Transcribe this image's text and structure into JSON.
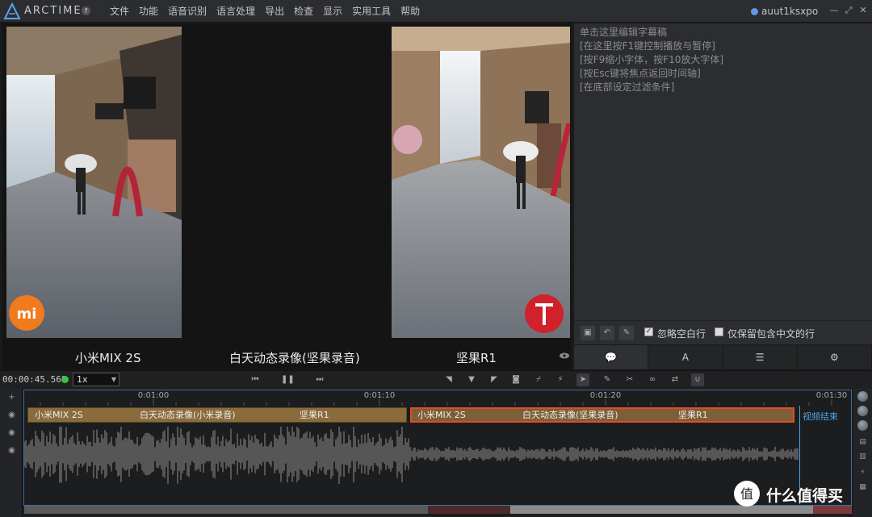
{
  "app": {
    "brand": "ARCTIME",
    "badge": "f",
    "menu": [
      "文件",
      "功能",
      "语音识别",
      "语言处理",
      "导出",
      "检查",
      "显示",
      "实用工具",
      "帮助"
    ],
    "user": "auut1ksxpo"
  },
  "video": {
    "captions": {
      "left": "小米MIX 2S",
      "center": "白天动态录像(坚果录音)",
      "right": "坚果R1"
    }
  },
  "subtitle_panel": {
    "lines": [
      "单击这里编辑字幕稿",
      "[在这里按F1键控制播放与暂停]",
      "[按F9缩小字体，按F10放大字体]",
      "[按Esc键将焦点返回时间轴]",
      "[在底部设定过滤条件]"
    ],
    "ignore_blank_label": "忽略空白行",
    "ignore_blank_checked": true,
    "keep_chinese_label": "仅保留包含中文的行",
    "keep_chinese_checked": false,
    "tabs": [
      "comment-icon",
      "font-icon",
      "list-icon",
      "settings-icon"
    ]
  },
  "transport": {
    "timecode": "00:00:45.568",
    "speed": "1x"
  },
  "timeline": {
    "ticks": [
      "0:01:00",
      "0:01:10",
      "0:01:20",
      "0:01:30"
    ],
    "segments": [
      {
        "parts": [
          "小米MIX 2S",
          "白天动态录像(小米录音)",
          "坚果R1"
        ]
      },
      {
        "parts": [
          "小米MIX 2S",
          "白天动态录像(坚果录音)",
          "坚果R1"
        ]
      }
    ],
    "end_label": "视频结束"
  },
  "watermark": {
    "text": "什么值得买",
    "logo_char": "值"
  },
  "colors": {
    "accent": "#4da3e6",
    "selected_segment_border": "#e24a2a",
    "segment_fill": "#8a6b3c",
    "status_dot": "#3bc24a"
  }
}
